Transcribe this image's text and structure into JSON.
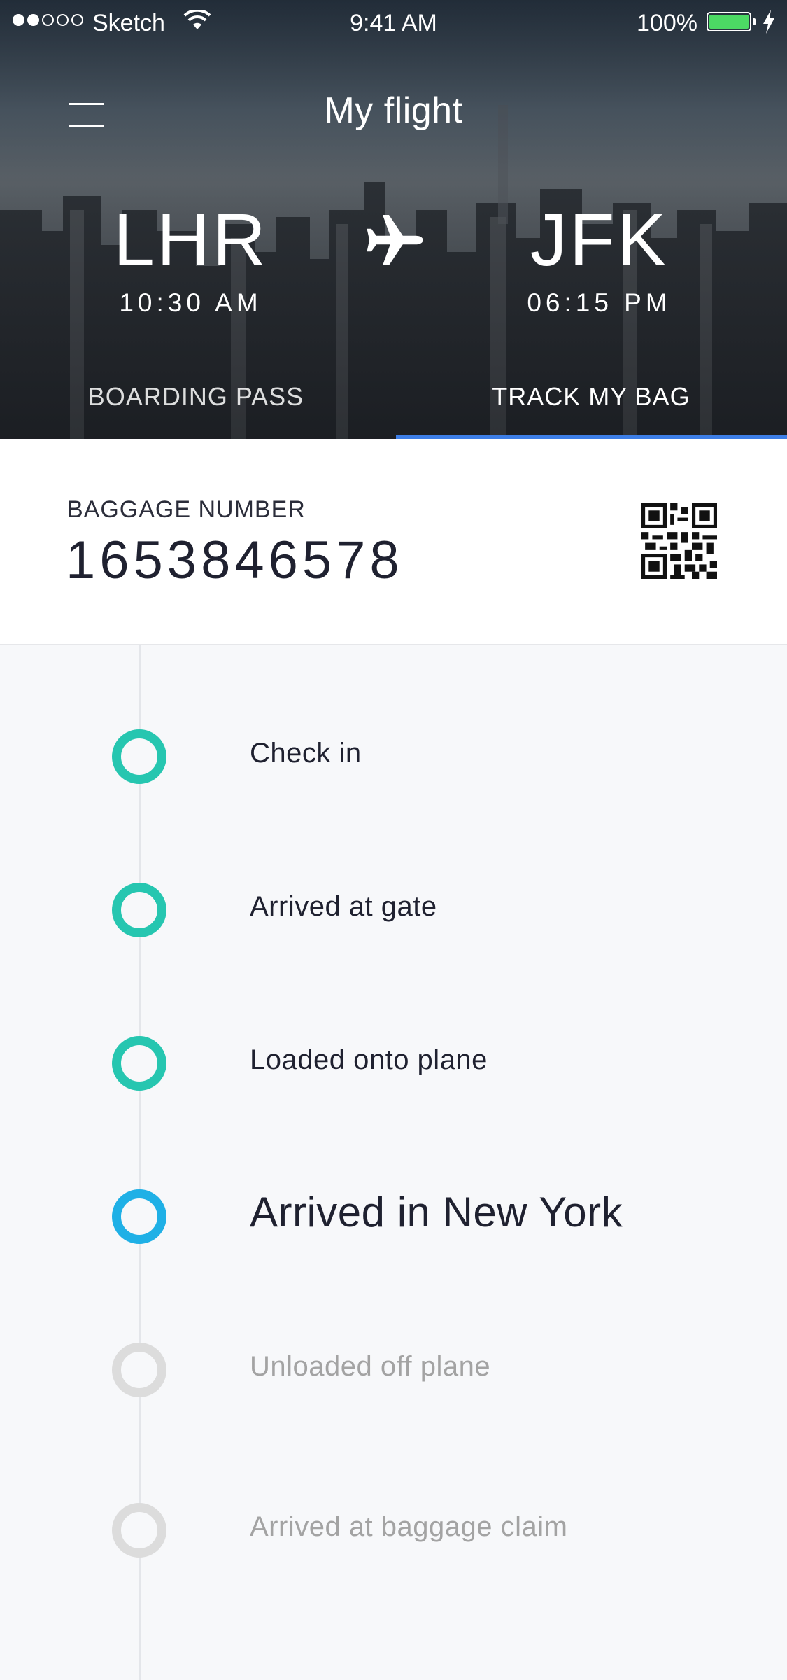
{
  "status_bar": {
    "carrier": "Sketch",
    "time": "9:41 AM",
    "battery_percent": "100%",
    "battery_color": "#4cd964"
  },
  "header": {
    "title": "My flight",
    "menu_icon": "hamburger-menu-icon",
    "origin": {
      "code": "LHR",
      "time": "10:30 AM"
    },
    "destination": {
      "code": "JFK",
      "time": "06:15 PM"
    },
    "plane_icon": "airplane-icon"
  },
  "tabs": [
    {
      "label": "BOARDING PASS",
      "active": false
    },
    {
      "label": "TRACK MY BAG",
      "active": true
    }
  ],
  "accent_color": "#3d7ee6",
  "baggage": {
    "label": "BAGGAGE NUMBER",
    "number": "1653846578",
    "qr_icon": "qr-code-icon"
  },
  "timeline": {
    "steps": [
      {
        "label": "Check in",
        "state": "done"
      },
      {
        "label": "Arrived at gate",
        "state": "done"
      },
      {
        "label": "Loaded onto plane",
        "state": "done"
      },
      {
        "label": "Arrived in New York",
        "state": "current"
      },
      {
        "label": "Unloaded off plane",
        "state": "pending"
      },
      {
        "label": "Arrived at baggage claim",
        "state": "pending"
      }
    ],
    "colors": {
      "done": "#26c6b0",
      "current": "#1fb0e6",
      "pending": "#dcdcdc"
    }
  }
}
